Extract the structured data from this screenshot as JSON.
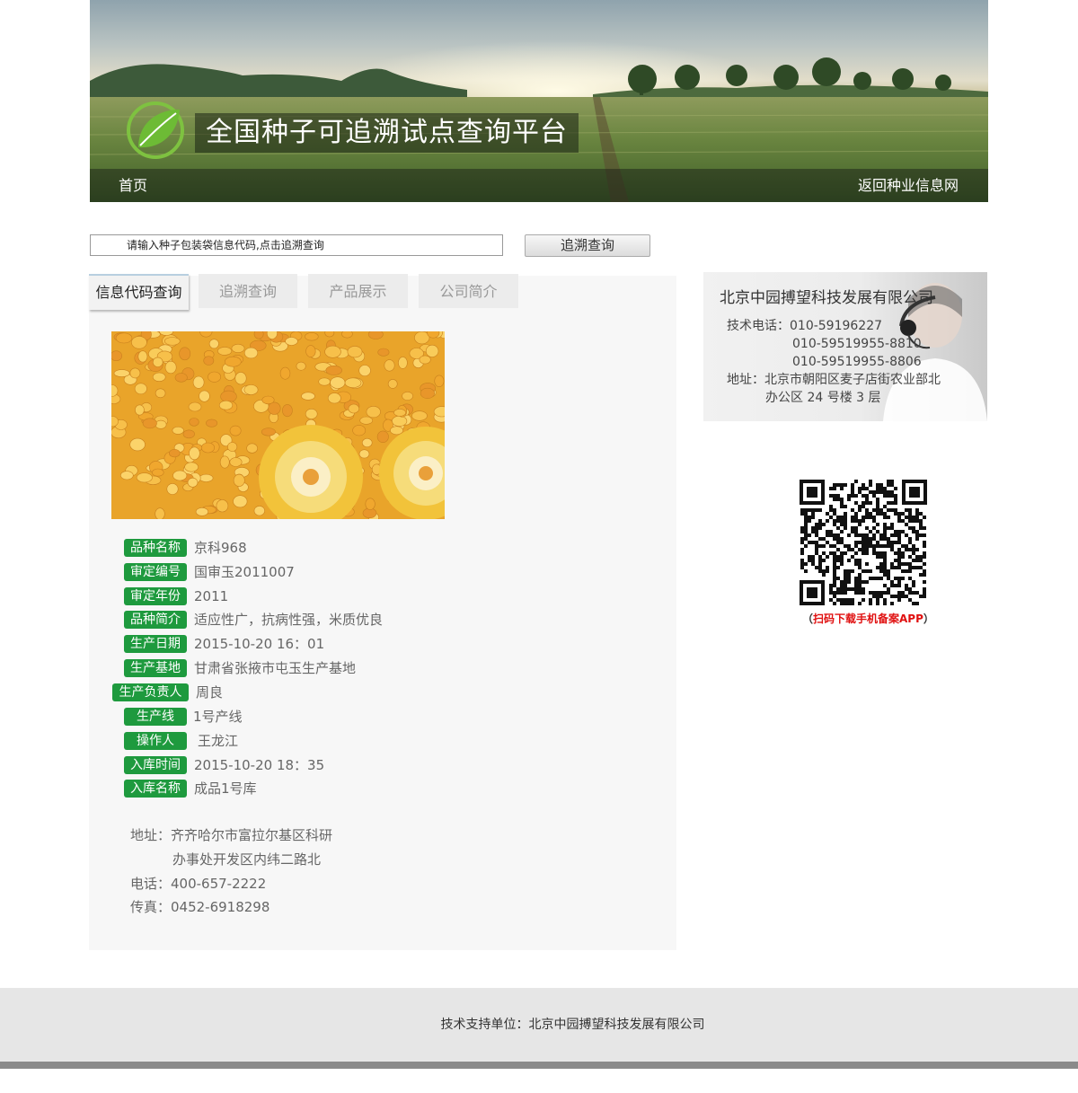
{
  "header": {
    "site_title": "全国种子可追溯试点查询平台",
    "nav_home": "首页",
    "nav_back": "返回种业信息网"
  },
  "search": {
    "placeholder": "请输入种子包装袋信息代码,点击追溯查询",
    "button_label": "追溯查询"
  },
  "tabs": [
    {
      "label": "信息代码查询",
      "active": true
    },
    {
      "label": "追溯查询",
      "active": false
    },
    {
      "label": "产品展示",
      "active": false
    },
    {
      "label": "公司简介",
      "active": false
    }
  ],
  "product": {
    "image_icon": "corn-kernels-photo",
    "fields": [
      {
        "label": "品种名称",
        "value": "京科968"
      },
      {
        "label": "审定编号",
        "value": "国审玉2011007"
      },
      {
        "label": "审定年份",
        "value": "2011"
      },
      {
        "label": "品种简介",
        "value": "适应性广，抗病性强，米质优良"
      },
      {
        "label": "生产日期",
        "value": "2015-10-20 16：01"
      },
      {
        "label": "生产基地",
        "value": "甘肃省张掖市屯玉生产基地"
      },
      {
        "label": "生产负责人",
        "value": "周良"
      },
      {
        "label": "生产线",
        "value": "1号产线"
      },
      {
        "label": "操作人",
        "value": "王龙江"
      },
      {
        "label": "入库时间",
        "value": "2015-10-20 18：35"
      },
      {
        "label": "入库名称",
        "value": "成品1号库"
      }
    ],
    "address_line1": "地址：齐齐哈尔市富拉尔基区科研",
    "address_line2": "办事处开发区内纬二路北",
    "phone": "电话：400-657-2222",
    "fax": "传真：0452-6918298"
  },
  "contact": {
    "company": "北京中园搏望科技发展有限公司",
    "tech_phone_label": "技术电话：010-59196227",
    "phone2": "010-59519955-8810",
    "phone3": "010-59519955-8806",
    "address_line1": "地址：北京市朝阳区麦子店街农业部北",
    "address_line2": "办公区 24 号楼 3 层"
  },
  "qr": {
    "caption_open": "（",
    "caption": "扫码下载手机备案APP",
    "caption_close": "）"
  },
  "footer": {
    "text": "技术支持单位：北京中园搏望科技发展有限公司"
  },
  "colors": {
    "badge_green": "#1e9a3e",
    "qr_caption_red": "#e01010",
    "panel_bg": "#f7f7f7",
    "footer_bg": "#e6e6e6"
  }
}
